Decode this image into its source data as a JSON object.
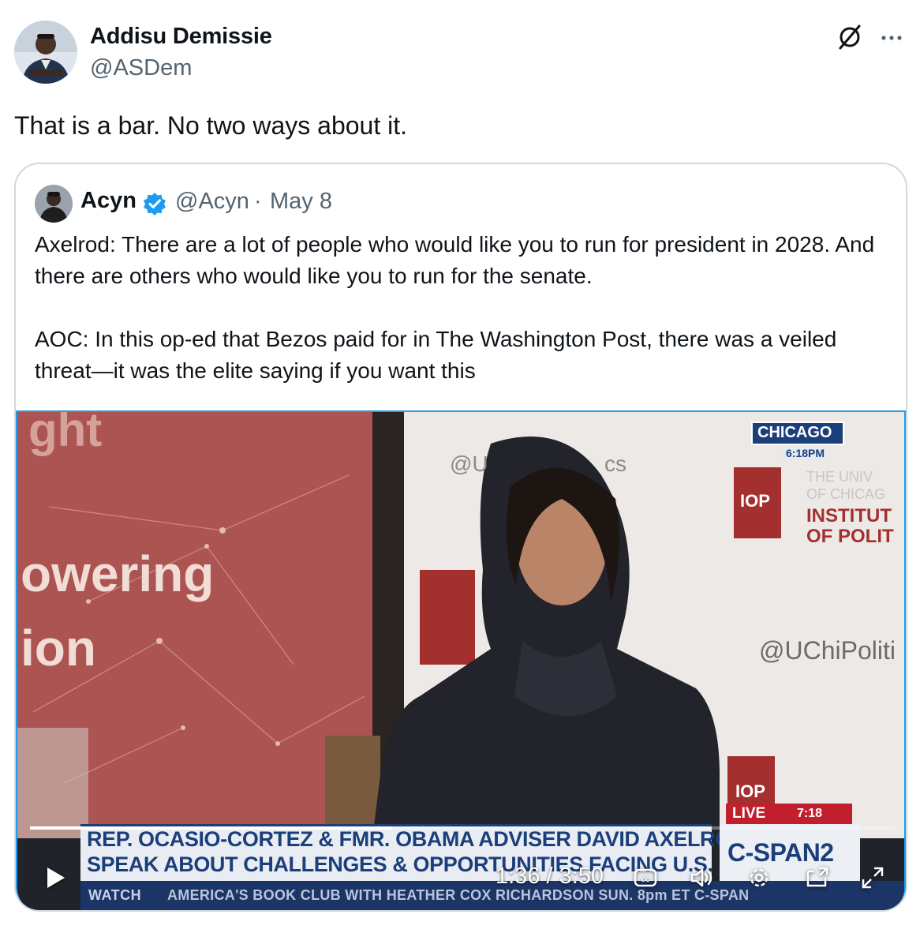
{
  "tweet": {
    "author_name": "Addisu Demissie",
    "author_handle": "@ASDem",
    "text": "That is a bar. No two ways about it.",
    "icons": {
      "grok": "grok-slash-icon",
      "more": "more-horizontal-icon"
    }
  },
  "quoted": {
    "author_name": "Acyn",
    "verified": true,
    "verified_color": "#1d9bf0",
    "author_handle": "@Acyn",
    "separator": "·",
    "date": "May 8",
    "paragraphs": [
      "Axelrod: There are a lot of people who would like you to run for president in 2028. And there are others who would like you to run for the senate.",
      "AOC: In this op-ed that Bezos paid for in The Washington Post, there was a veiled threat—it was the elite saying if you want this"
    ],
    "video": {
      "backdrop_words": [
        "ght",
        "owering",
        "ion"
      ],
      "backdrop_handle_top": "@U",
      "backdrop_handle_top_suffix": "cs",
      "backdrop_handle_right": "@UChiPoliti",
      "iop_label": "IOP",
      "institute_lines": [
        "THE UNIV",
        "OF CHICAG",
        "INSTITUT",
        "OF POLIT"
      ],
      "chicago_label": "CHICAGO",
      "chicago_time": "6:18PM",
      "live_label": "LIVE",
      "live_time": "7:18",
      "headline_line1": "REP. OCASIO-CORTEZ & FMR. OBAMA ADVISER DAVID AXELROD",
      "headline_line2": "SPEAK ABOUT CHALLENGES & OPPORTUNITIES FACING U.S.",
      "network": "C-SPAN2",
      "watch_label": "WATCH",
      "lower_ticker": "AMERICA'S BOOK CLUB WITH HEATHER COX RICHARDSON SUN. 8pm ET C-SPAN",
      "current_time": "1:36",
      "duration": "3:50",
      "time_display": "1:36 / 3:50",
      "progress_fraction": 0.418,
      "controls": [
        "play-icon",
        "closed-captions-icon",
        "volume-icon",
        "settings-icon",
        "picture-in-picture-icon",
        "fullscreen-icon"
      ]
    }
  },
  "colors": {
    "text_primary": "#0f1419",
    "text_secondary": "#536471",
    "border": "#cfd9de",
    "accent": "#1d9bf0",
    "cspan_blue": "#1b3f7a",
    "live_red": "#c21f2e"
  }
}
